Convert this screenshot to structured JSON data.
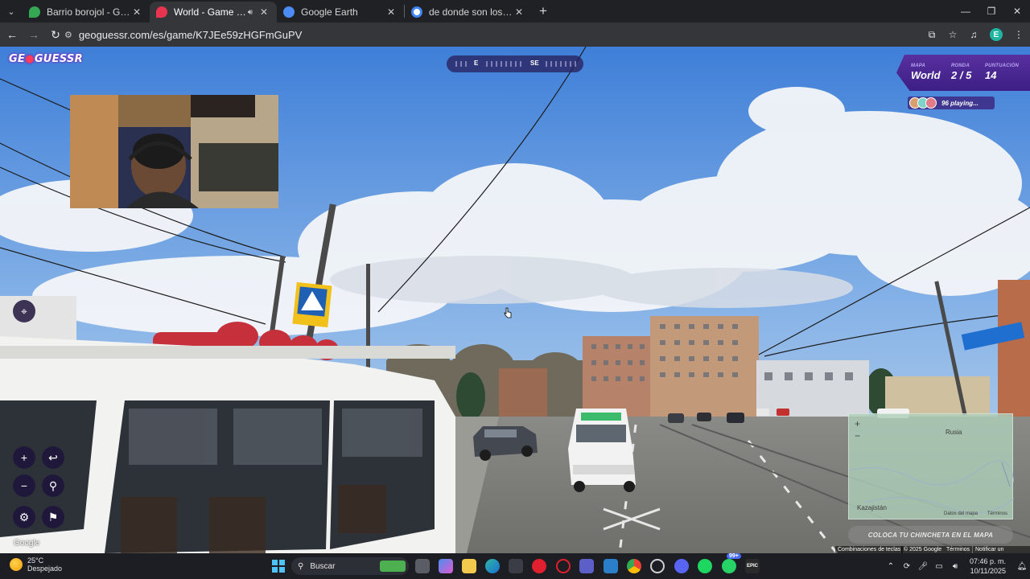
{
  "browser": {
    "tabs": [
      {
        "title": "Barrio borojol - Google Maps",
        "favicon_color": "#34a853",
        "active": false
      },
      {
        "title": "World - Game - GeoGuessr",
        "favicon_color": "#e8344e",
        "active": true,
        "audio": true
      },
      {
        "title": "Google Earth",
        "favicon_color": "#4c8bf5",
        "active": false
      },
      {
        "title": "de donde son los duendes - Bu",
        "favicon_color": "#ffffff",
        "active": false
      }
    ],
    "url": "geoguessr.com/es/game/K7JEe59zHGFmGuPV"
  },
  "game": {
    "logo_left": "GE",
    "logo_right": "GUESSR",
    "compass": {
      "label_e": "E",
      "label_se": "SE"
    },
    "status": {
      "map_label": "MAPA",
      "map_value": "World",
      "round_label": "RONDA",
      "round_value": "2 / 5",
      "score_label": "PUNTUACIÓN",
      "score_value": "14"
    },
    "players_text": "96 playing...",
    "google_watermark": "Google",
    "minimap": {
      "label_russia": "Rusia",
      "label_kazakhstan": "Kazajistán",
      "google": "Google",
      "map_data": "Datos del mapa",
      "terms": "Términos"
    },
    "guess_button": "COLOCA TU CHINCHETA EN EL MAPA",
    "attribution": {
      "shortcuts": "Combinaciones de teclas",
      "copyright": "© 2025 Google",
      "terms": "Términos",
      "report": "Notificar un problema"
    }
  },
  "taskbar": {
    "temperature": "25°C",
    "condition": "Despejado",
    "search_placeholder": "Buscar",
    "badge": "99+",
    "time": "07:46 p. m.",
    "date": "10/11/2025"
  }
}
